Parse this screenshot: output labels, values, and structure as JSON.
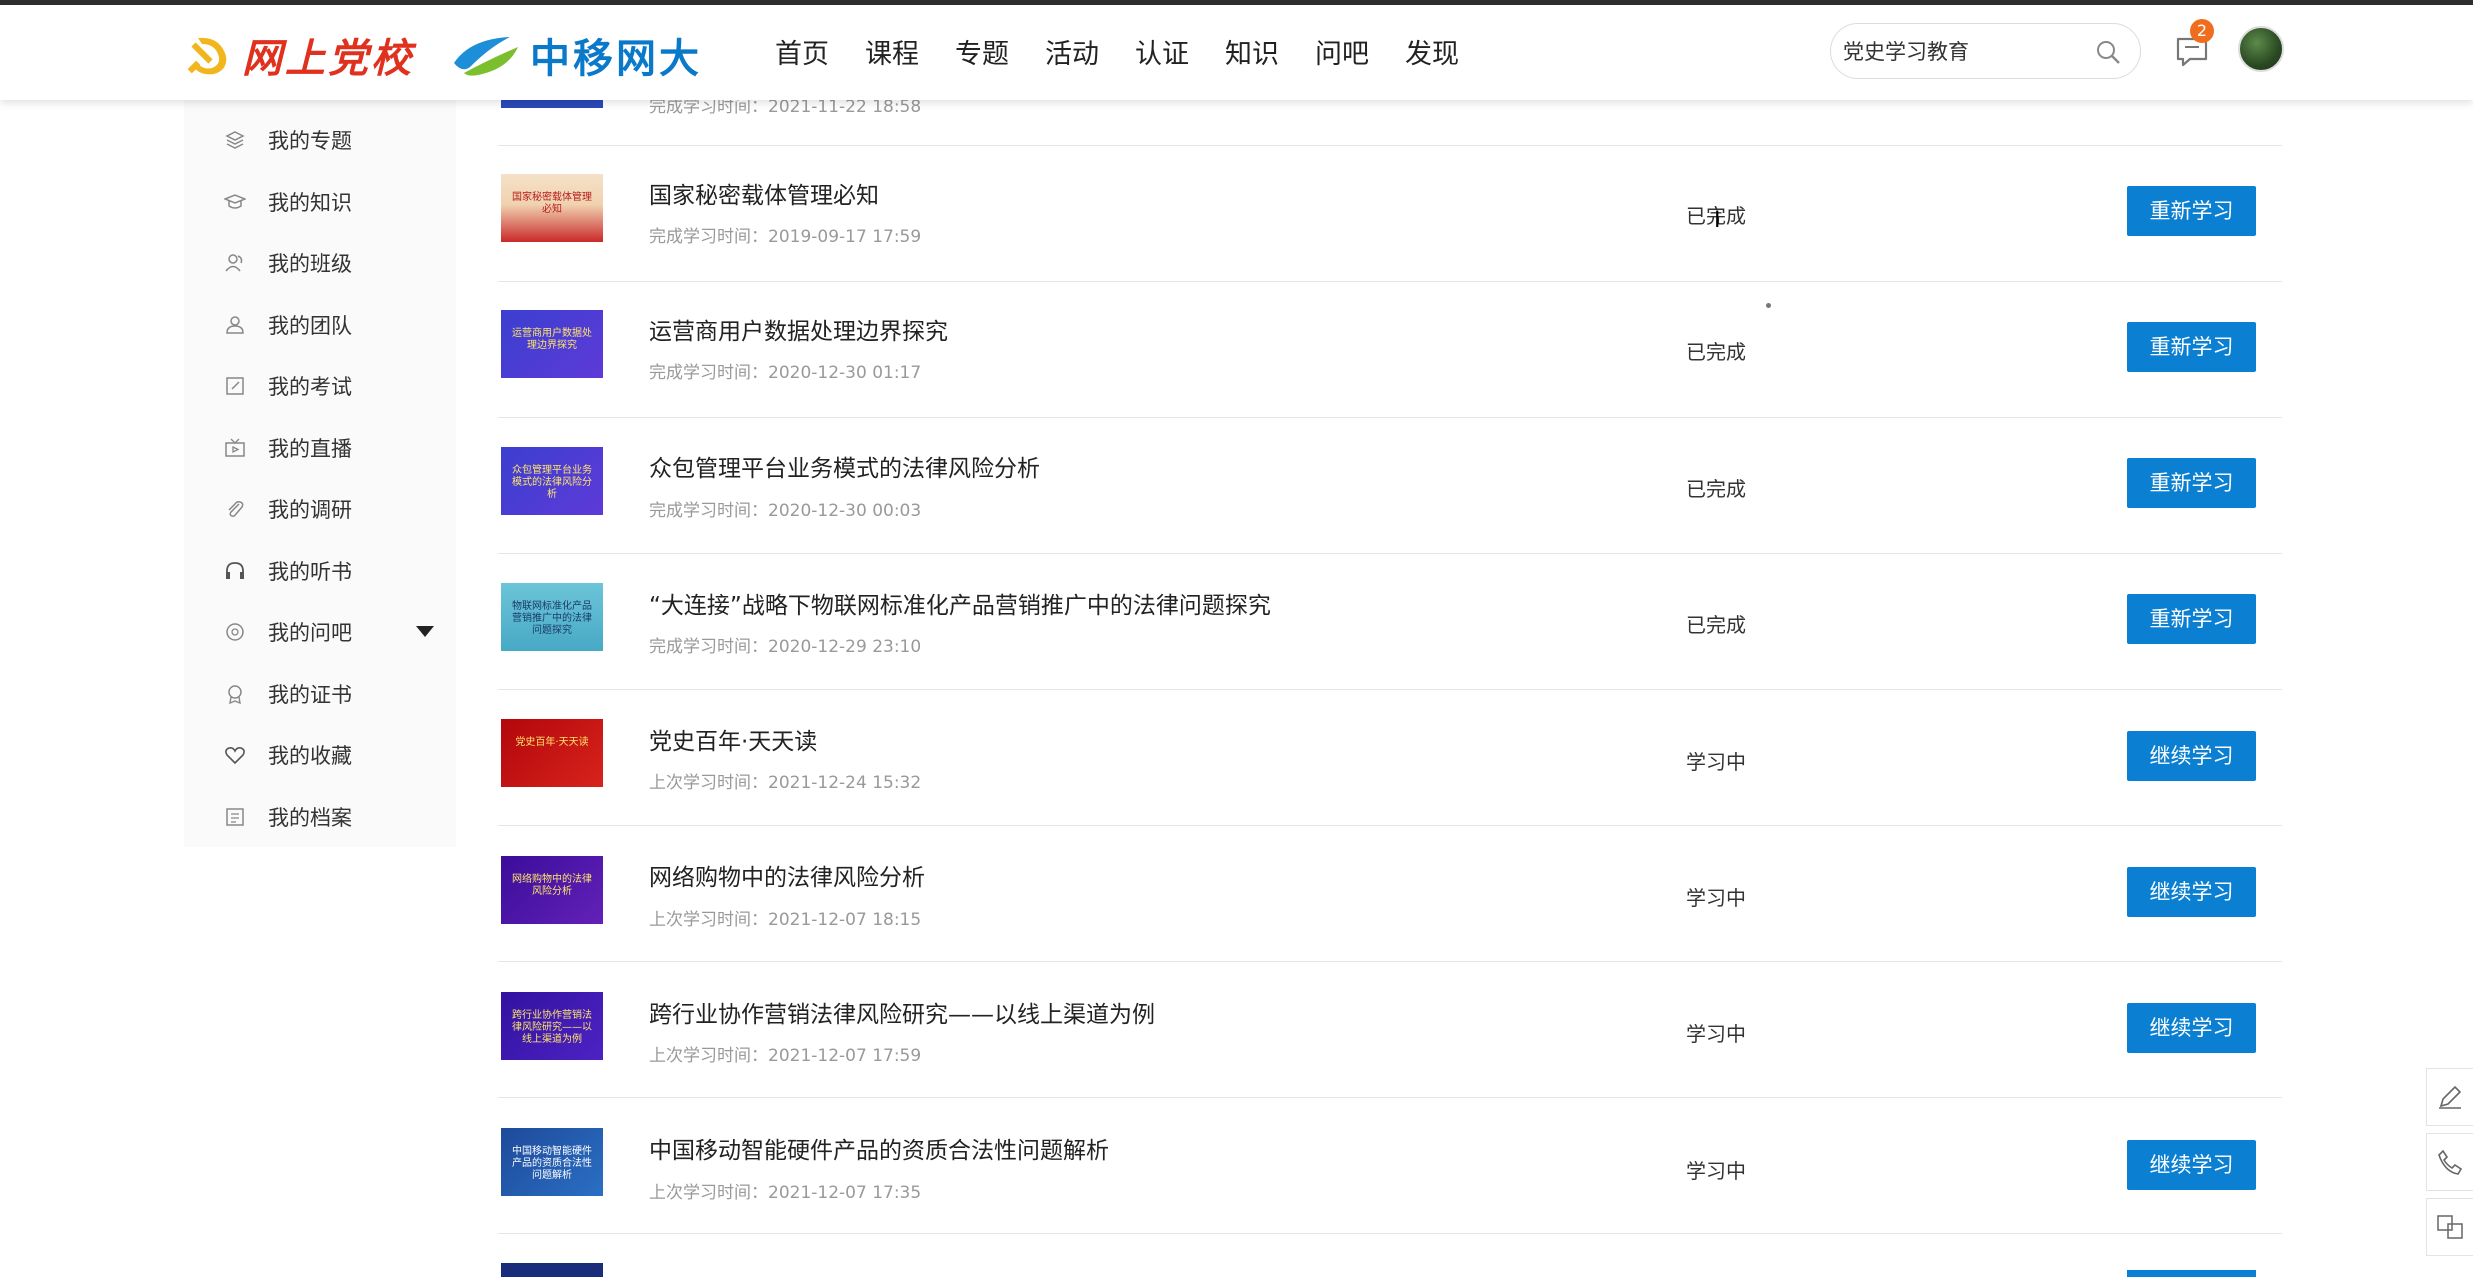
{
  "header": {
    "logo_left": "网上党校",
    "logo_right": "中移网大",
    "nav": [
      "首页",
      "课程",
      "专题",
      "活动",
      "认证",
      "知识",
      "问吧",
      "发现"
    ],
    "search_value": "党史学习教育",
    "message_badge": "2"
  },
  "sidebar": {
    "items": [
      {
        "label": "我的专题",
        "icon": "layers-icon"
      },
      {
        "label": "我的知识",
        "icon": "graduation-cap-icon"
      },
      {
        "label": "我的班级",
        "icon": "user-group-icon"
      },
      {
        "label": "我的团队",
        "icon": "team-icon"
      },
      {
        "label": "我的考试",
        "icon": "exam-edit-icon"
      },
      {
        "label": "我的直播",
        "icon": "live-tv-icon"
      },
      {
        "label": "我的调研",
        "icon": "paperclip-icon"
      },
      {
        "label": "我的听书",
        "icon": "headphones-icon"
      },
      {
        "label": "我的问吧",
        "icon": "question-icon",
        "has_dropdown": true
      },
      {
        "label": "我的证书",
        "icon": "certificate-icon"
      },
      {
        "label": "我的收藏",
        "icon": "heart-icon"
      },
      {
        "label": "我的档案",
        "icon": "archive-icon"
      }
    ]
  },
  "courses": {
    "partial_top_time": "完成学习时间：2021-11-22 18:58",
    "items": [
      {
        "title": "国家秘密载体管理必知",
        "time": "完成学习时间：2019-09-17 17:59",
        "status": "已完成",
        "button": "重新学习",
        "thumb_text": "国家秘密载体管理必知"
      },
      {
        "title": "运营商用户数据处理边界探究",
        "time": "完成学习时间：2020-12-30 01:17",
        "status": "已完成",
        "button": "重新学习",
        "thumb_text": "运营商用户数据处理边界探究"
      },
      {
        "title": "众包管理平台业务模式的法律风险分析",
        "time": "完成学习时间：2020-12-30 00:03",
        "status": "已完成",
        "button": "重新学习",
        "thumb_text": "众包管理平台业务模式的法律风险分析"
      },
      {
        "title": "“大连接”战略下物联网标准化产品营销推广中的法律问题探究",
        "time": "完成学习时间：2020-12-29 23:10",
        "status": "已完成",
        "button": "重新学习",
        "thumb_text": "物联网标准化产品营销推广中的法律问题探究"
      },
      {
        "title": "党史百年·天天读",
        "time": "上次学习时间：2021-12-24 15:32",
        "status": "学习中",
        "button": "继续学习",
        "thumb_text": "党史百年·天天读"
      },
      {
        "title": "网络购物中的法律风险分析",
        "time": "上次学习时间：2021-12-07 18:15",
        "status": "学习中",
        "button": "继续学习",
        "thumb_text": "网络购物中的法律风险分析"
      },
      {
        "title": "跨行业协作营销法律风险研究——以线上渠道为例",
        "time": "上次学习时间：2021-12-07 17:59",
        "status": "学习中",
        "button": "继续学习",
        "thumb_text": "跨行业协作营销法律风险研究——以线上渠道为例"
      },
      {
        "title": "中国移动智能硬件产品的资质合法性问题解析",
        "time": "上次学习时间：2021-12-07 17:35",
        "status": "学习中",
        "button": "继续学习",
        "thumb_text": "中国移动智能硬件产品的资质合法性问题解析"
      }
    ]
  }
}
